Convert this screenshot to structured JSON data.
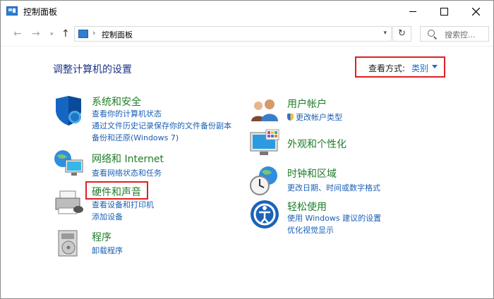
{
  "window": {
    "title": "控制面板",
    "minimize_icon": "minimize-icon",
    "maximize_icon": "maximize-icon",
    "close_icon": "close-icon"
  },
  "address": {
    "path": "控制面板",
    "separator": "›",
    "search_placeholder": "搜索控..."
  },
  "main": {
    "heading": "调整计算机的设置",
    "view_by_label": "查看方式:",
    "view_by_value": "类别"
  },
  "categories_left": [
    {
      "title": "系统和安全",
      "icon": "shield-icon",
      "links": [
        "查看你的计算机状态",
        "通过文件历史记录保存你的文件备份副本",
        "备份和还原(Windows 7)"
      ]
    },
    {
      "title": "网络和 Internet",
      "icon": "network-globe-icon",
      "links": [
        "查看网络状态和任务"
      ]
    },
    {
      "title": "硬件和声音",
      "icon": "printer-icon",
      "links": [
        "查看设备和打印机",
        "添加设备"
      ]
    },
    {
      "title": "程序",
      "icon": "programs-disc-icon",
      "links": [
        "卸载程序"
      ]
    }
  ],
  "categories_right": [
    {
      "title": "用户帐户",
      "icon": "users-icon",
      "links": [
        "更改帐户类型"
      ]
    },
    {
      "title": "外观和个性化",
      "icon": "monitor-colors-icon",
      "links": []
    },
    {
      "title": "时钟和区域",
      "icon": "clock-globe-icon",
      "links": [
        "更改日期、时间或数字格式"
      ]
    },
    {
      "title": "轻松使用",
      "icon": "ease-of-access-icon",
      "links": [
        "使用 Windows 建议的设置",
        "优化视觉显示"
      ]
    }
  ],
  "colors": {
    "category_title": "#1e7d28",
    "link": "#1a5fb4",
    "heading": "#1e3287",
    "highlight_border": "#e02020"
  }
}
